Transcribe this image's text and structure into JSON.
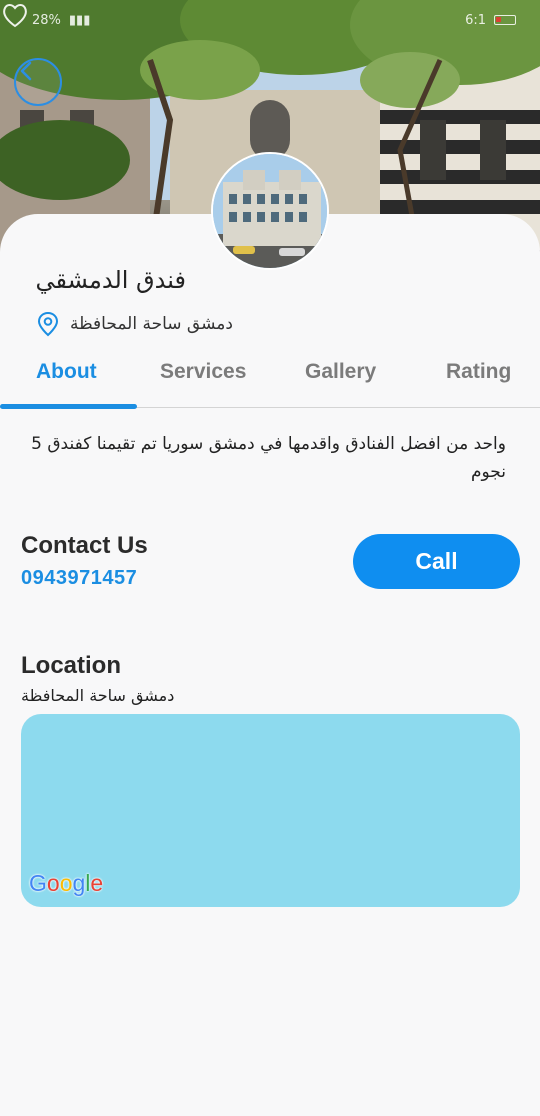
{
  "status_bar": {
    "battery": "28%",
    "time": "6:1"
  },
  "hotel": {
    "name": "فندق الدمشقي",
    "address": "دمشق ساحة المحافظة"
  },
  "tabs": [
    {
      "label": "About",
      "active": true
    },
    {
      "label": "Services",
      "active": false
    },
    {
      "label": "Gallery",
      "active": false
    },
    {
      "label": "Rating",
      "active": false
    }
  ],
  "about": {
    "description": "واحد من افضل الفنادق واقدمها في دمشق سوريا تم تقيمنا كفندق 5 نجوم"
  },
  "contact": {
    "title": "Contact Us",
    "phone": "0943971457",
    "call_label": "Call"
  },
  "location": {
    "title": "Location",
    "address": "دمشق ساحة المحافظة",
    "map_brand": "Google"
  },
  "icons": {
    "back": "back-arrow-icon",
    "favorite": "heart-icon",
    "location": "location-pin-icon"
  },
  "colors": {
    "accent": "#1b8ee2",
    "call_button": "#0f8ef0",
    "map": "#8ddaee",
    "tab_inactive": "#7b7b7b"
  }
}
